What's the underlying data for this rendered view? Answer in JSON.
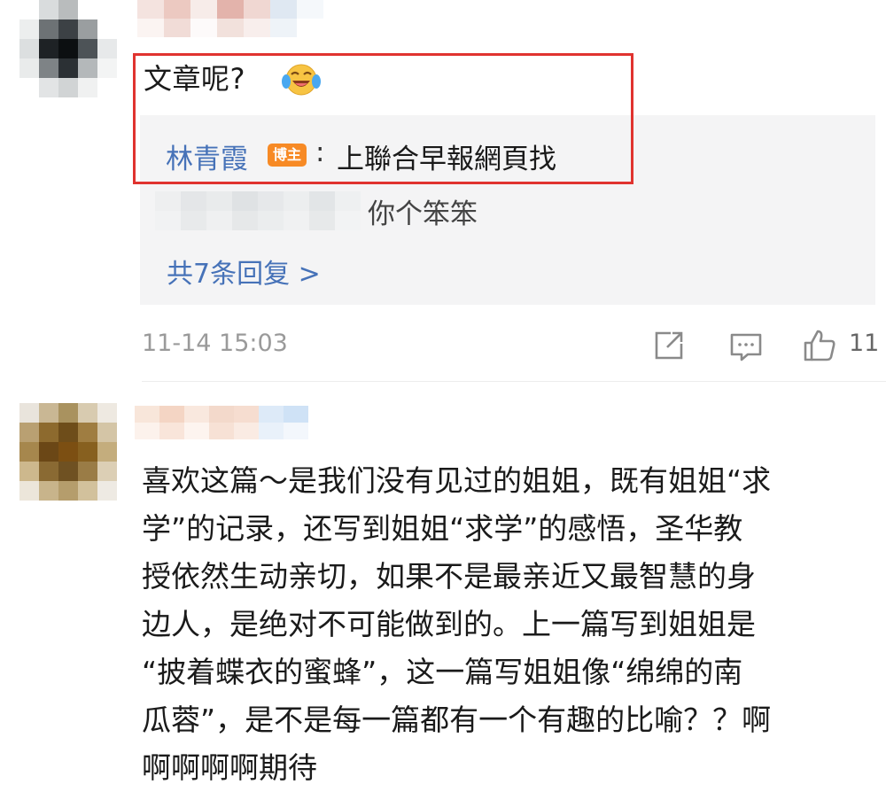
{
  "comment1": {
    "text": "文章呢?",
    "emoji_icon": "laughing-crying-emoji-icon",
    "reply1": {
      "author": "林青霞",
      "badge": "博主",
      "separator": ":",
      "text": "上聯合早報網頁找"
    },
    "reply2": {
      "text": "你个笨笨"
    },
    "more_replies": "共7条回复 >",
    "timestamp": "11-14 15:03",
    "like_count": "11",
    "highlight_color": "#e0332f"
  },
  "comment2": {
    "lines": [
      "喜欢这篇～是我们没有见过的姐姐，既有姐姐“求",
      "学”的记录，还写到姐姐“求学”的感悟，圣华教",
      "授依然生动亲切，如果不是最亲近又最智慧的身",
      "边人，是绝对不可能做到的。上一篇写到姐姐是",
      "“披着蝶衣的蜜蜂”，这一篇写姐姐像“绵绵的南",
      "瓜蓉”，是不是每一篇都有一个有趣的比喻？？啊",
      "啊啊啊啊期待"
    ]
  },
  "colors": {
    "link_blue": "#4672b8",
    "badge_orange": "#f78a25",
    "reply_bg": "#f4f4f5",
    "meta_gray": "#9a9a9a"
  }
}
